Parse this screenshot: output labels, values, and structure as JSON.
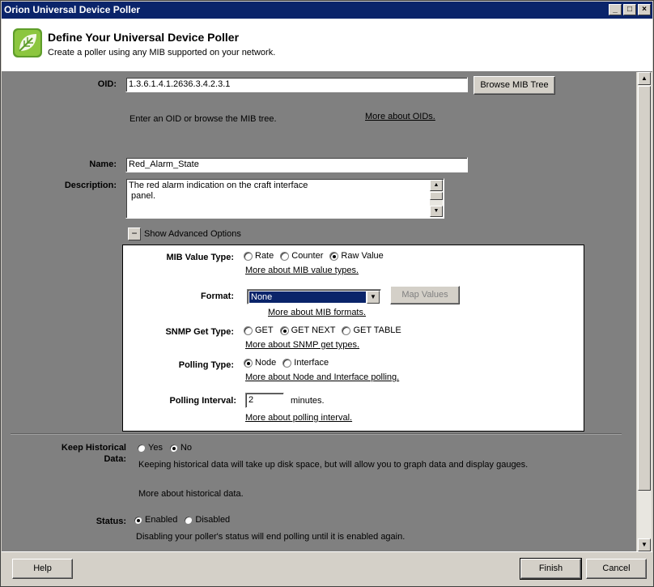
{
  "window": {
    "title": "Orion Universal Device Poller"
  },
  "header": {
    "title": "Define Your Universal Device Poller",
    "subtitle": "Create a poller using any MIB supported on your network."
  },
  "oid": {
    "label": "OID:",
    "value": "1.3.6.1.4.1.2636.3.4.2.3.1",
    "browse_button": "Browse MIB Tree",
    "help_text": "Enter an OID or browse the MIB tree.",
    "more_link": "More about OIDs."
  },
  "name": {
    "label": "Name:",
    "value": "Red_Alarm_State"
  },
  "description": {
    "label": "Description:",
    "line1": "The red alarm indication on the craft interface",
    "line2": " panel."
  },
  "advanced": {
    "toggle_symbol": "−",
    "label": "Show Advanced Options",
    "mib_value_type": {
      "label": "MIB Value Type:",
      "options": [
        "Rate",
        "Counter",
        "Raw Value"
      ],
      "selected": "Raw Value",
      "more_link": "More about MIB value types."
    },
    "format": {
      "label": "Format:",
      "value": "None",
      "map_button": "Map Values",
      "more_link": "More about MIB formats."
    },
    "snmp_get_type": {
      "label": "SNMP Get Type:",
      "options": [
        "GET",
        "GET NEXT",
        "GET TABLE"
      ],
      "selected": "GET NEXT",
      "more_link": "More about SNMP get types."
    },
    "polling_type": {
      "label": "Polling Type:",
      "options": [
        "Node",
        "Interface"
      ],
      "selected": "Node",
      "more_link": "More about Node and Interface polling."
    },
    "polling_interval": {
      "label": "Polling Interval:",
      "value": "2",
      "unit": "minutes.",
      "more_link": "More about polling interval."
    }
  },
  "historical": {
    "label_line1": "Keep Historical",
    "label_line2": "Data:",
    "options": [
      "Yes",
      "No"
    ],
    "selected": "No",
    "help_text": "Keeping historical data will take up disk space, but will allow you to graph data and display gauges.",
    "more_text": "More about historical data."
  },
  "status": {
    "label": "Status:",
    "options": [
      "Enabled",
      "Disabled"
    ],
    "selected": "Enabled",
    "help_text": "Disabling your poller's status will end polling until it is enabled again."
  },
  "footer": {
    "help": "Help",
    "finish": "Finish",
    "cancel": "Cancel"
  },
  "colors": {
    "title_bar": "#0a246a",
    "form_background": "#808080",
    "panel_background": "#ffffff",
    "logo_green": "#6fae2f"
  }
}
